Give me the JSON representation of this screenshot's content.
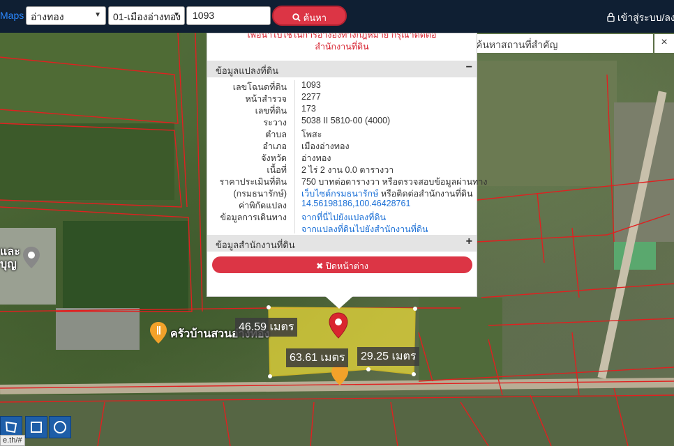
{
  "nav": {
    "brand": "Maps",
    "province_select": "อ่างทอง",
    "district_select": "01-เมืองอ่างทอง",
    "parcel_number": "1093",
    "search_button": "ค้นหา",
    "login": "เข้าสู่ระบบ/ลงทะ"
  },
  "landmark_search": {
    "placeholder": "ค้นหาสถานที่สำคัญ",
    "close": "×"
  },
  "popup": {
    "notice_line1": "เพื่อนำไปใช้ในการอ้างอิงทางกฎหมาย กรุณาติดต่อ",
    "notice_line2": "สำนักงานที่ดิน",
    "section1_title": "ข้อมูลแปลงที่ดิน",
    "section1_toggle": "−",
    "section2_title": "ข้อมูลสำนักงานที่ดิน",
    "section2_toggle": "+",
    "close_button": "ปิดหน้าต่าง",
    "rows": [
      {
        "label": "เลขโฉนดที่ดิน",
        "value": "1093"
      },
      {
        "label": "หน้าสำรวจ",
        "value": "2277"
      },
      {
        "label": "เลขที่ดิน",
        "value": "173"
      },
      {
        "label": "ระวาง",
        "value": "5038 II 5810-00 (4000)"
      },
      {
        "label": "ตำบล",
        "value": "โพสะ"
      },
      {
        "label": "อำเภอ",
        "value": "เมืองอ่างทอง"
      },
      {
        "label": "จังหวัด",
        "value": "อ่างทอง"
      },
      {
        "label": "เนื้อที่",
        "value": "2 ไร่ 2 งาน 0.0 ตารางวา"
      },
      {
        "label": "ราคาประเมินที่ดิน",
        "value": "750 บาทต่อตารางวา หรือตรวจสอบข้อมูลผ่านทาง"
      },
      {
        "label": "(กรมธนารักษ์)",
        "value": "เว็บไซต์กรมธนารักษ์",
        "value_suffix": " หรือติดต่อสำนักงานที่ดิน"
      },
      {
        "label": "ค่าพิกัดแปลง",
        "value": "14.56198186,100.46428761"
      },
      {
        "label": "ข้อมูลการเดินทาง",
        "value": "จากที่นี่ไปยังแปลงที่ดิน"
      },
      {
        "label": "",
        "value": "จากแปลงที่ดินไปยังสำนักงานที่ดิน"
      }
    ]
  },
  "map": {
    "measure_labels": [
      "46.59 เมตร",
      "63.61 เมตร",
      "29.25 เมตร"
    ],
    "place_label": "ครัวบ้านสวนอ่างทอง",
    "left_label_1": "และ",
    "left_label_2": "บุญ",
    "status_url": "e.th/#"
  },
  "colors": {
    "nav_bg": "#0f1f33",
    "accent_red": "#dc3545",
    "parcel_fill": "#e8d83a",
    "boundary": "#e02020",
    "link": "#1a6fd6"
  }
}
